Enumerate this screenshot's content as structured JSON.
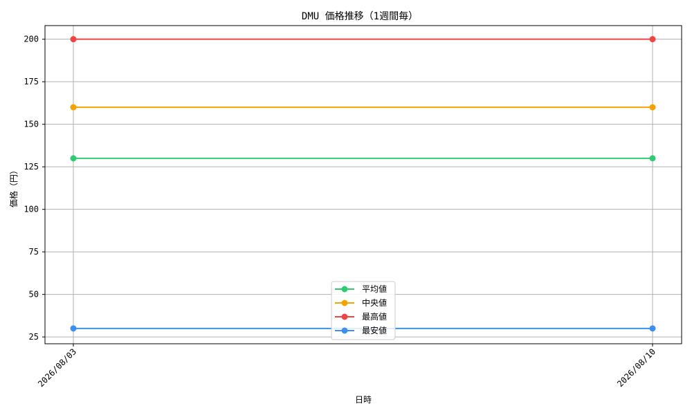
{
  "chart_data": {
    "type": "line",
    "title": "DMU 価格推移（1週間毎）",
    "xlabel": "日時",
    "ylabel": "価格（円）",
    "categories": [
      "2026/08/03",
      "2026/08/10"
    ],
    "ylim": [
      21,
      208
    ],
    "yticks": [
      25,
      50,
      75,
      100,
      125,
      150,
      175,
      200
    ],
    "grid": true,
    "legend_position": "lower center",
    "series": [
      {
        "name": "平均値",
        "values": [
          130,
          130
        ],
        "color": "#2ecc71"
      },
      {
        "name": "中央値",
        "values": [
          160,
          160
        ],
        "color": "#f5a300"
      },
      {
        "name": "最高値",
        "values": [
          200,
          200
        ],
        "color": "#ef4444"
      },
      {
        "name": "最安値",
        "values": [
          30,
          30
        ],
        "color": "#3b8fef"
      }
    ]
  }
}
